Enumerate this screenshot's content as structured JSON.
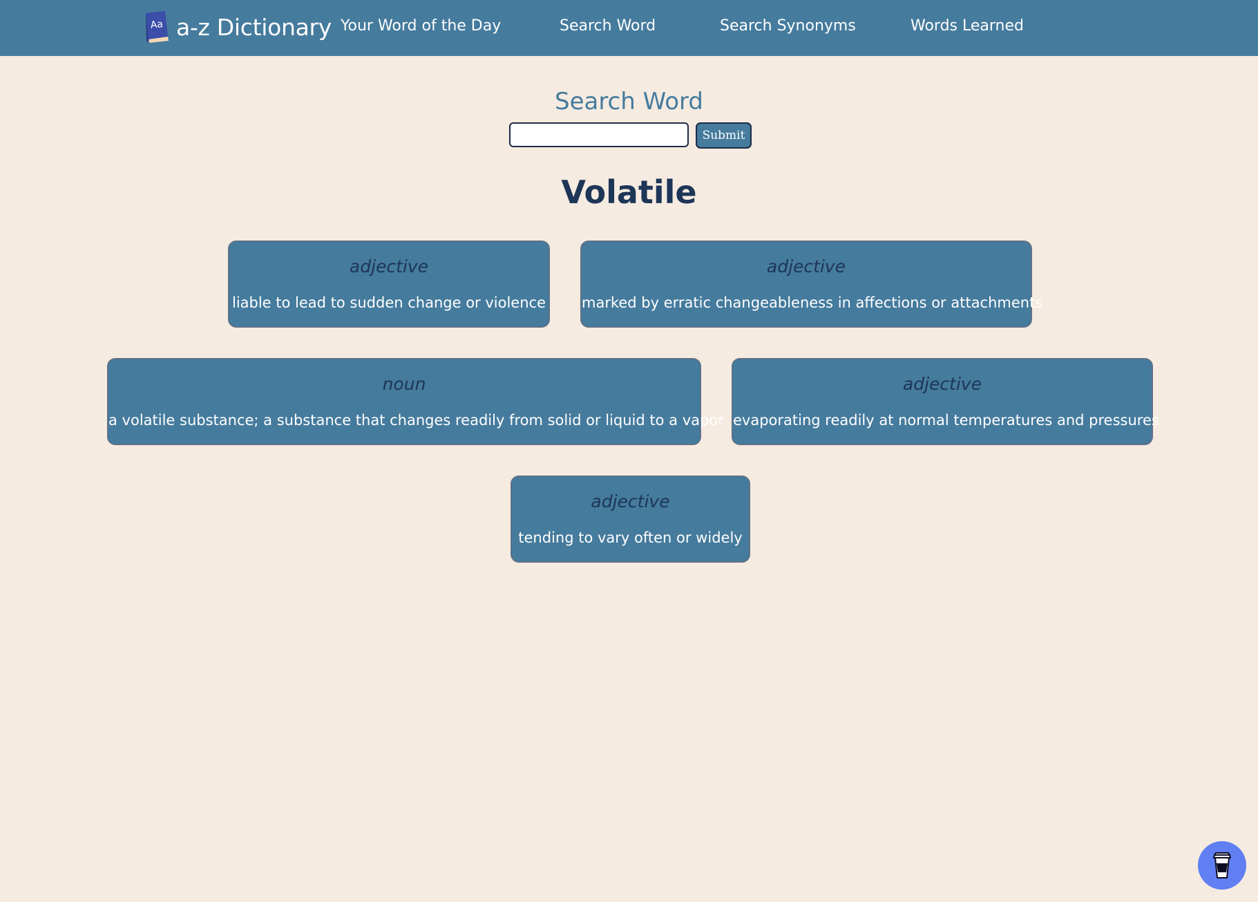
{
  "nav": {
    "brand_title": "a-z Dictionary",
    "logo_icon": "book-icon",
    "logo_text": "Aa",
    "links": [
      "Your Word of the Day",
      "Search Word",
      "Search Synonyms",
      "Words Learned"
    ]
  },
  "search": {
    "title": "Search Word",
    "input_value": "",
    "submit_label": "Submit"
  },
  "result": {
    "word": "Volatile",
    "definitions": [
      {
        "pos": "adjective",
        "text": "liable to lead to sudden change or violence"
      },
      {
        "pos": "adjective",
        "text": "marked by erratic changeableness in affections or attachments"
      },
      {
        "pos": "noun",
        "text": "a volatile substance; a substance that changes readily from solid or liquid to a vapor"
      },
      {
        "pos": "adjective",
        "text": "evaporating readily at normal temperatures and pressures"
      },
      {
        "pos": "adjective",
        "text": "tending to vary often or widely"
      }
    ]
  },
  "fab": {
    "icon": "coffee-cup-icon"
  },
  "colors": {
    "navbar": "#457b9d",
    "background": "#f5ebe1",
    "card": "#457b9d",
    "heading": "#1d3557",
    "fab": "#5f7ff2"
  }
}
